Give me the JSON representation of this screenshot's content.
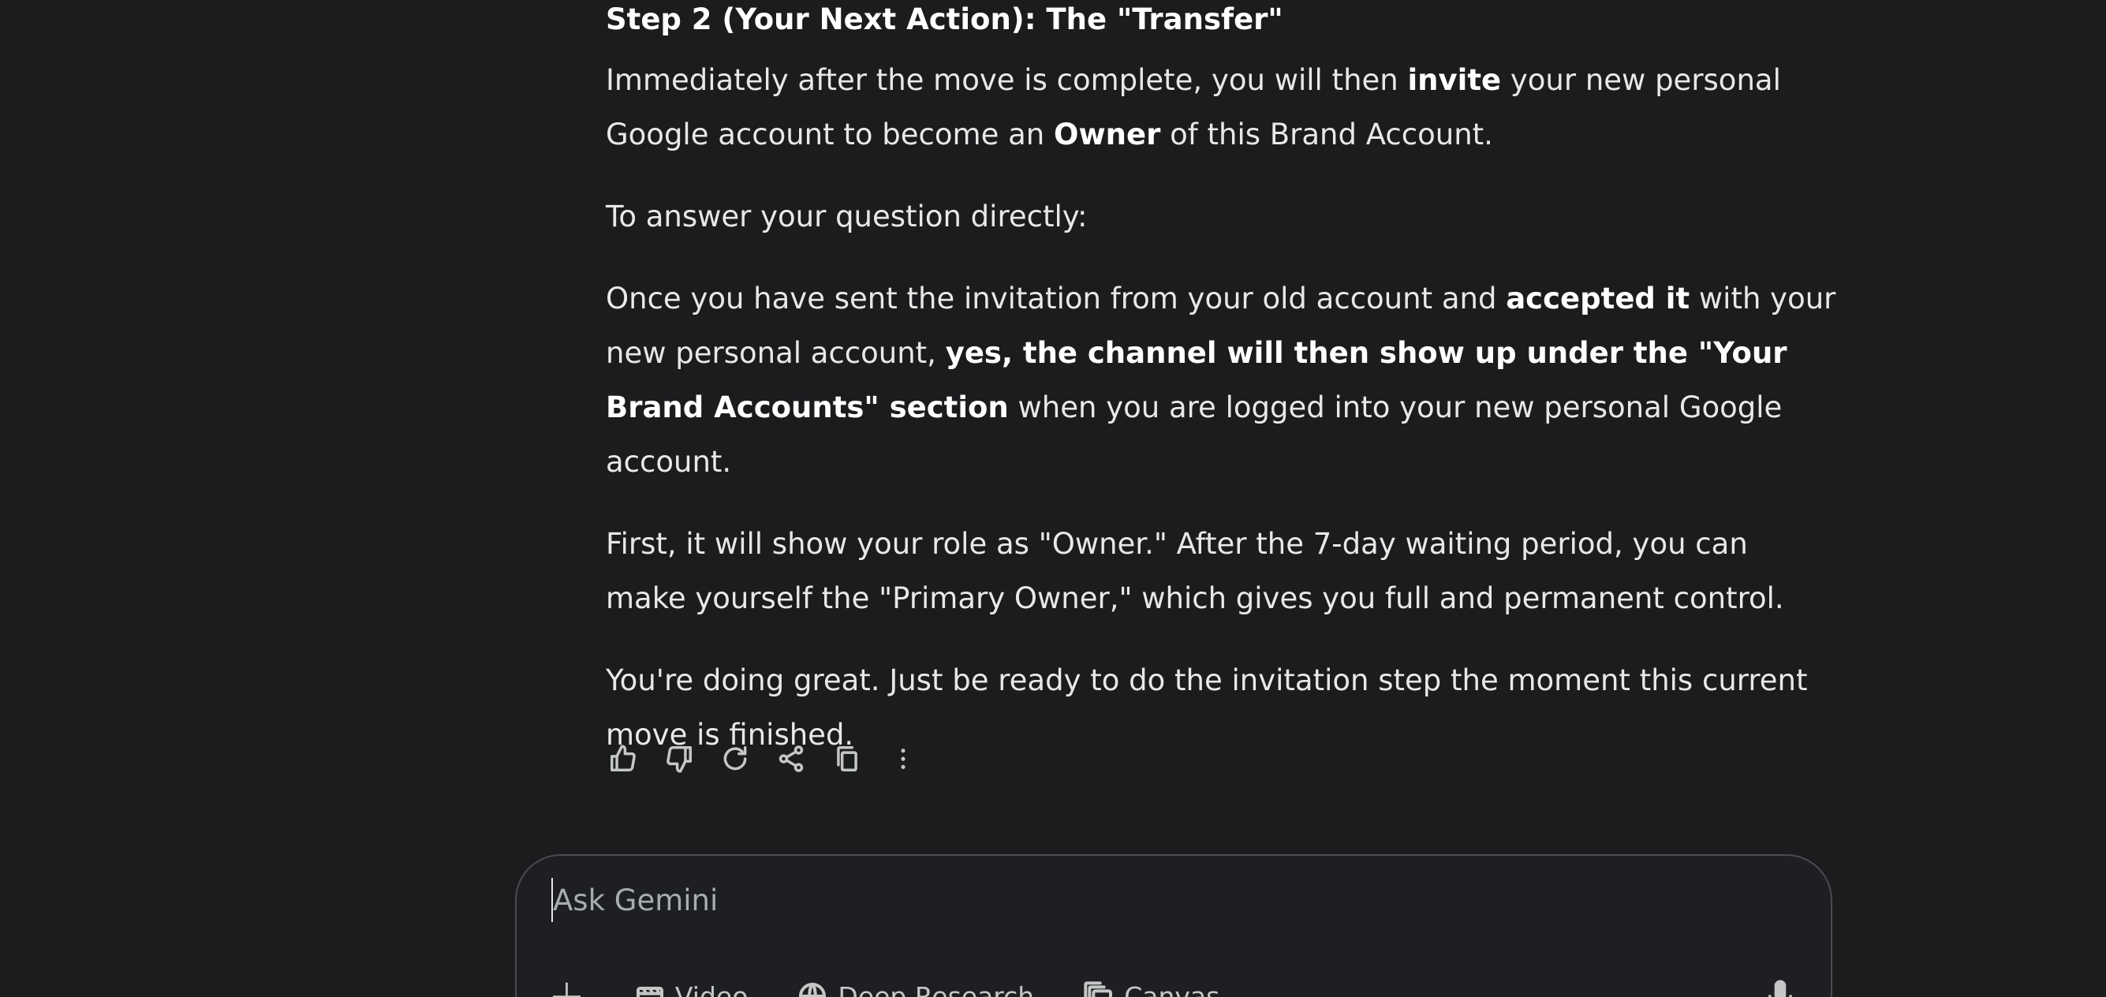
{
  "response": {
    "step_heading": "Step 2 (Your Next Action): The \"Transfer\"",
    "p1": {
      "t1": "Immediately after the move is complete, you will then ",
      "b1": "invite",
      "t2": " your new personal Google account to become an ",
      "b2": "Owner",
      "t3": " of this Brand Account."
    },
    "p2": "To answer your question directly:",
    "p3": {
      "t1": "Once you have sent the invitation from your old account and ",
      "b1": "accepted it",
      "t2": " with your new personal account, ",
      "b2": "yes, the channel will then show up under the \"Your Brand Accounts\" section",
      "t3": " when you are logged into your new personal Google account."
    },
    "p4": "First, it will show your role as \"Owner.\" After the 7-day waiting period, you can make yourself the \"Primary Owner,\" which gives you full and permanent control.",
    "p5": "You're doing great. Just be ready to do the invitation step the moment this current move is finished."
  },
  "actions": {
    "icons": [
      "thumbs-up-icon",
      "thumbs-down-icon",
      "regenerate-icon",
      "share-icon",
      "copy-icon",
      "more-vert-icon"
    ]
  },
  "input": {
    "placeholder": "Ask Gemini",
    "value": ""
  },
  "tools": {
    "plus": "+",
    "video": "Video",
    "deep_research": "Deep Research",
    "canvas": "Canvas"
  },
  "colors": {
    "background": "#1b1c1e",
    "text": "#e3e3e3",
    "icon": "#c4c7c5",
    "input_border": "#4a4c50"
  }
}
